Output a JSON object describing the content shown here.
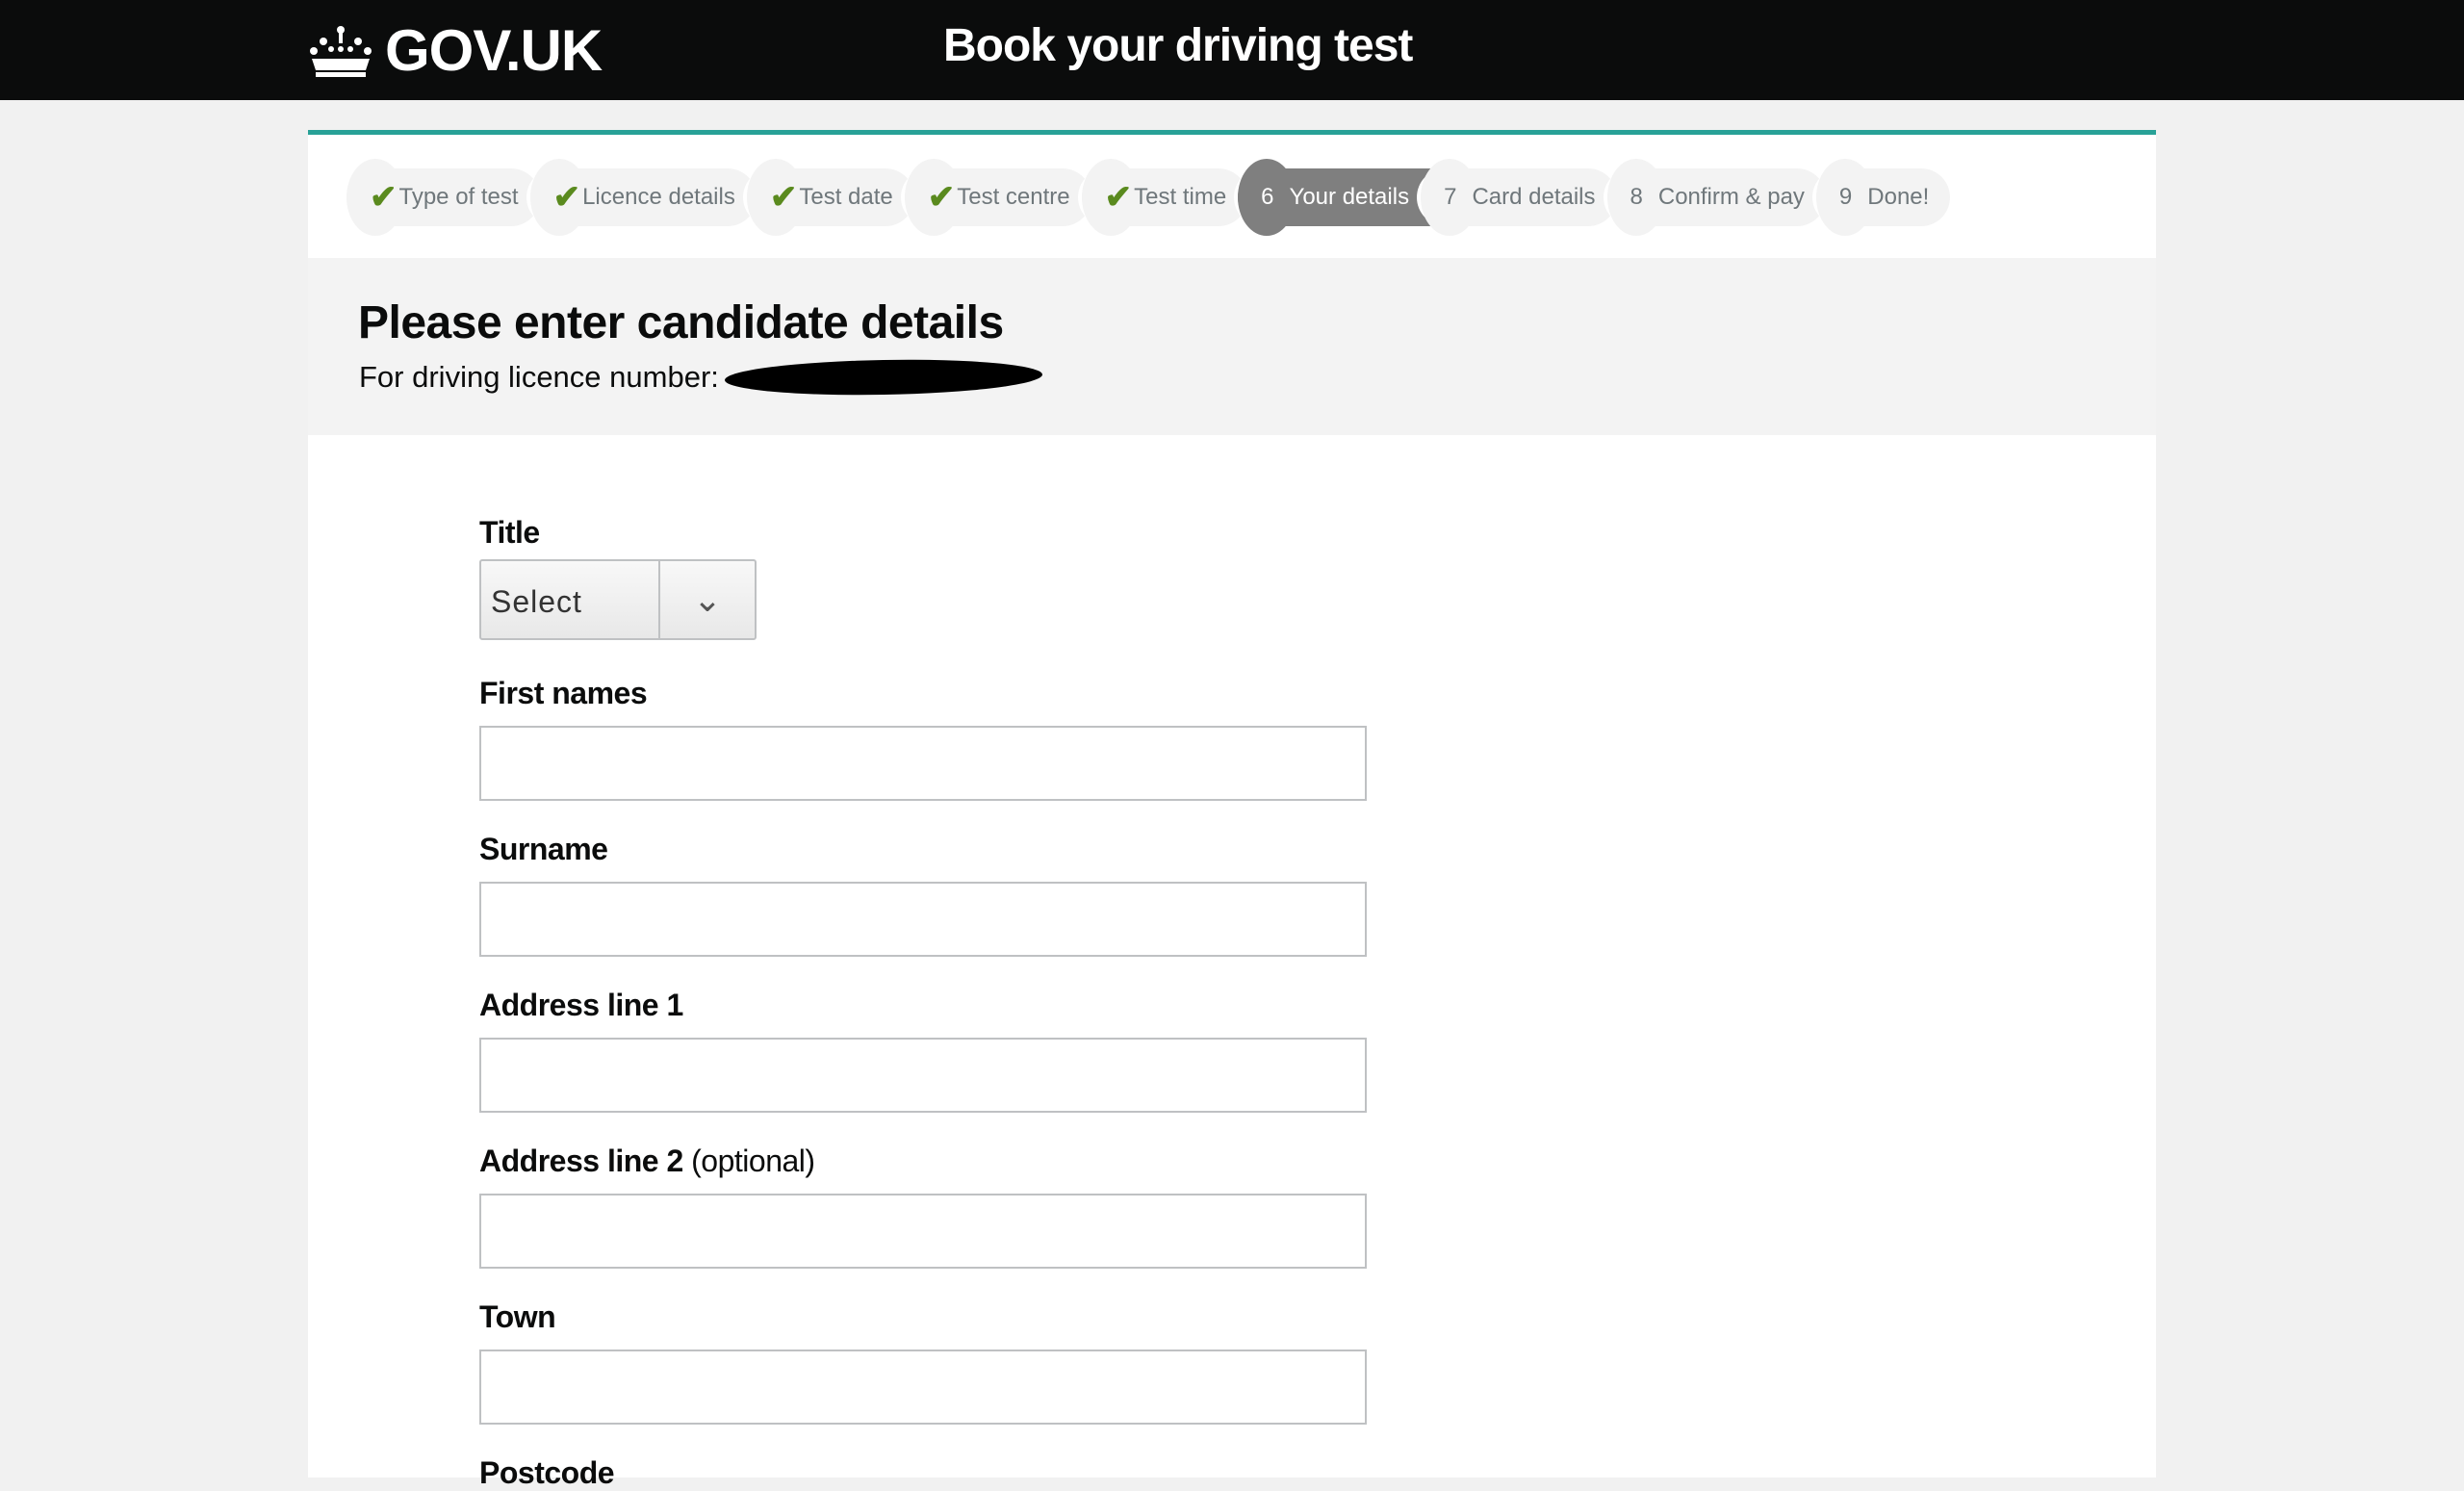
{
  "header": {
    "logo_text": "GOV.UK",
    "service_name": "Book your driving test"
  },
  "steps": [
    {
      "label": "Type of test",
      "status": "done"
    },
    {
      "label": "Licence details",
      "status": "done"
    },
    {
      "label": "Test date",
      "status": "done"
    },
    {
      "label": "Test centre",
      "status": "done"
    },
    {
      "label": "Test time",
      "status": "done"
    },
    {
      "number": "6",
      "label": "Your details",
      "status": "current"
    },
    {
      "number": "7",
      "label": "Card details",
      "status": "todo"
    },
    {
      "number": "8",
      "label": "Confirm & pay",
      "status": "todo"
    },
    {
      "number": "9",
      "label": "Done!",
      "status": "todo"
    }
  ],
  "page": {
    "title": "Please enter candidate details",
    "subtitle": "For driving licence number:"
  },
  "form": {
    "title_label": "Title",
    "title_value": "Select",
    "first_names_label": "First names",
    "surname_label": "Surname",
    "address1_label": "Address line 1",
    "address2_label": "Address line 2",
    "address2_hint": "(optional)",
    "town_label": "Town",
    "postcode_label": "Postcode"
  },
  "colors": {
    "header": "#0b0c0c",
    "accent": "#28a197",
    "check": "#5a8a1e",
    "current_step": "#7f7f7f"
  }
}
